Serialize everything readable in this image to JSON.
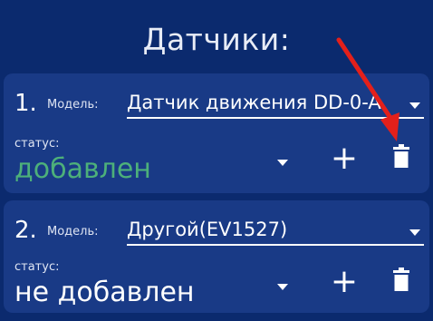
{
  "title": "Датчики:",
  "colors": {
    "background": "#0b2a6e",
    "card": "#193a86",
    "status_added": "#4db07a",
    "status_not_added": "#ffffff",
    "annotation_arrow": "#e3201b"
  },
  "sensors": [
    {
      "number": "1.",
      "model_label": "Модель:",
      "model_value": "Датчик движения DD-0-A",
      "status_label": "статус:",
      "status_value": "добавлен",
      "add_icon": "plus-icon",
      "delete_icon": "trash-icon"
    },
    {
      "number": "2.",
      "model_label": "Модель:",
      "model_value": "Другой(EV1527)",
      "status_label": "статус:",
      "status_value": "не добавлен",
      "add_icon": "plus-icon",
      "delete_icon": "trash-icon"
    }
  ]
}
